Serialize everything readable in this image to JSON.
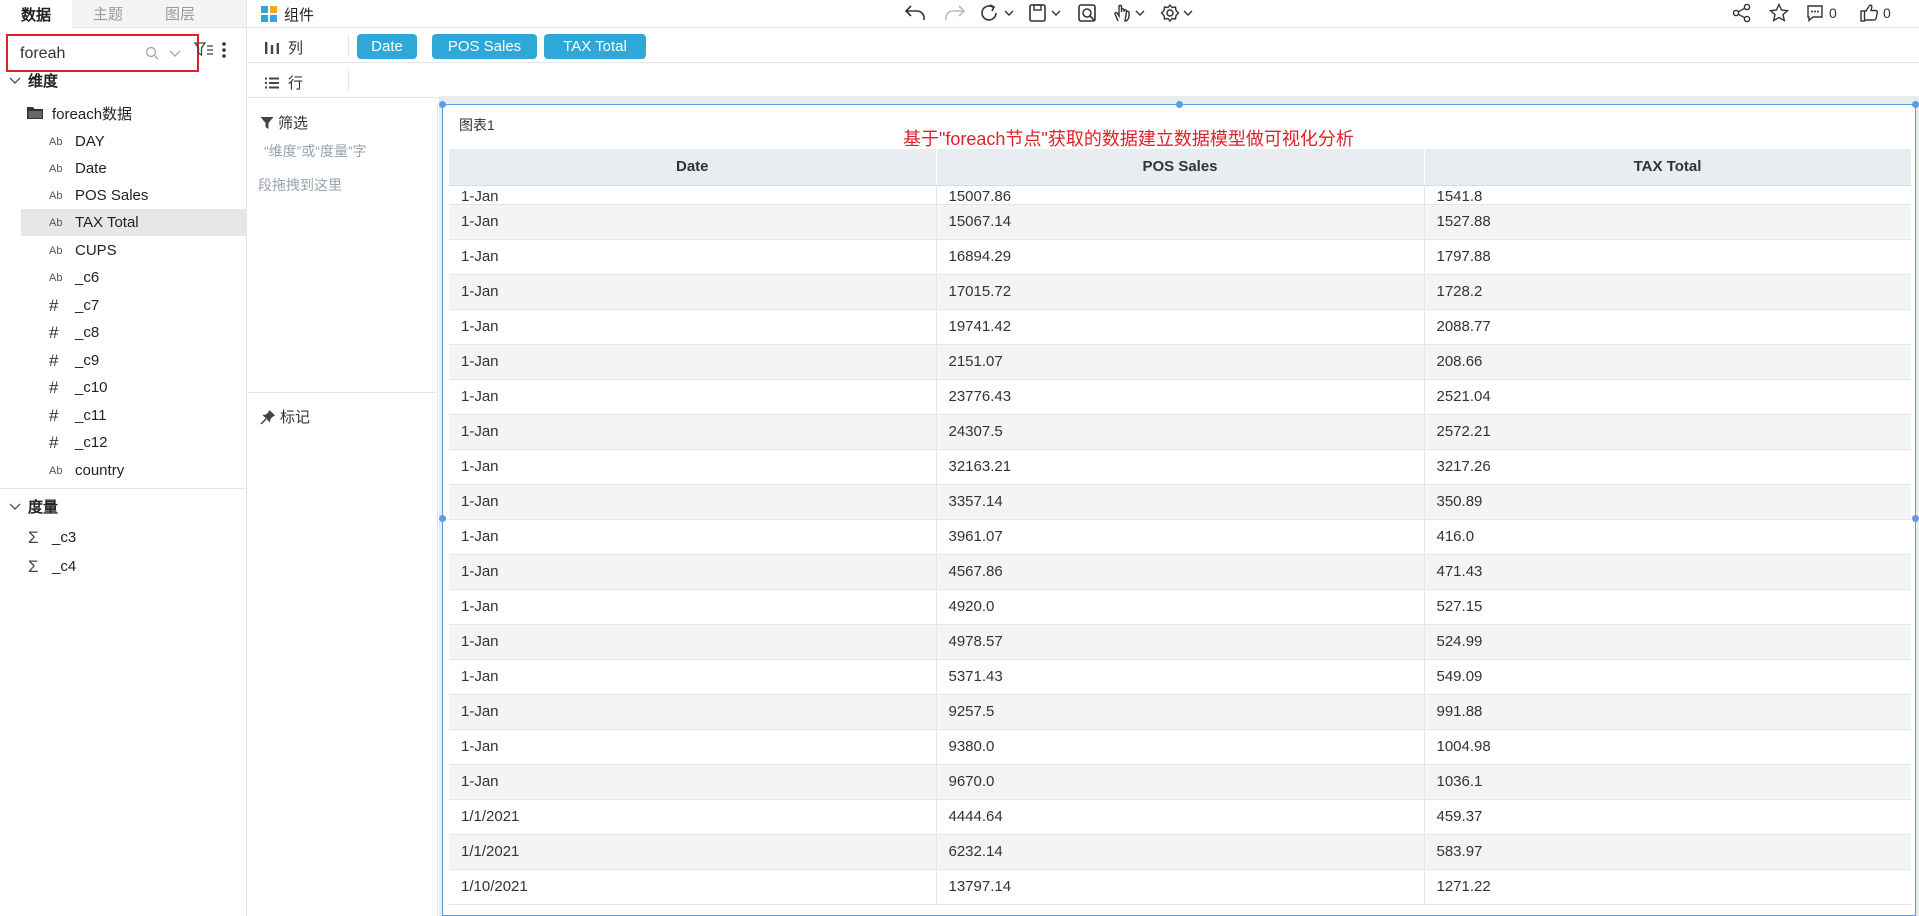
{
  "left_panel": {
    "tabs": [
      "数据",
      "主题",
      "图层"
    ],
    "search": {
      "value": "foreah"
    },
    "dimensions_header": "维度",
    "folder": "foreach数据",
    "fields": [
      {
        "type": "Ab",
        "name": "DAY"
      },
      {
        "type": "Ab",
        "name": "Date"
      },
      {
        "type": "Ab",
        "name": "POS Sales"
      },
      {
        "type": "Ab",
        "name": "TAX Total"
      },
      {
        "type": "Ab",
        "name": "CUPS"
      },
      {
        "type": "Ab",
        "name": "_c6"
      },
      {
        "type": "#",
        "name": "_c7"
      },
      {
        "type": "#",
        "name": "_c8"
      },
      {
        "type": "#",
        "name": "_c9"
      },
      {
        "type": "#",
        "name": "_c10"
      },
      {
        "type": "#",
        "name": "_c11"
      },
      {
        "type": "#",
        "name": "_c12"
      },
      {
        "type": "Ab",
        "name": "country"
      }
    ],
    "measures_header": "度量",
    "measures": [
      "_c3",
      "_c4"
    ],
    "measure_symbol": "Σ"
  },
  "toolbar": {
    "component_label": "组件",
    "comment_count": "0",
    "like_count": "0"
  },
  "shelves": {
    "columns_label": "列",
    "rows_label": "行",
    "column_pills": [
      "Date",
      "POS Sales",
      "TAX Total"
    ]
  },
  "filter_panel": {
    "filter_title": "筛选",
    "hint_line1": "“维度”或“度量”字",
    "hint_line2": "段拖拽到这里",
    "mark_title": "标记"
  },
  "chart": {
    "title": "图表1",
    "caption": "基于\"foreach节点\"获取的数据建立数据模型做可视化分析",
    "columns": [
      "Date",
      "POS Sales",
      "TAX Total"
    ],
    "rows": [
      [
        "1-Jan",
        "15007.86",
        "1541.8"
      ],
      [
        "1-Jan",
        "15067.14",
        "1527.88"
      ],
      [
        "1-Jan",
        "16894.29",
        "1797.88"
      ],
      [
        "1-Jan",
        "17015.72",
        "1728.2"
      ],
      [
        "1-Jan",
        "19741.42",
        "2088.77"
      ],
      [
        "1-Jan",
        "2151.07",
        "208.66"
      ],
      [
        "1-Jan",
        "23776.43",
        "2521.04"
      ],
      [
        "1-Jan",
        "24307.5",
        "2572.21"
      ],
      [
        "1-Jan",
        "32163.21",
        "3217.26"
      ],
      [
        "1-Jan",
        "3357.14",
        "350.89"
      ],
      [
        "1-Jan",
        "3961.07",
        "416.0"
      ],
      [
        "1-Jan",
        "4567.86",
        "471.43"
      ],
      [
        "1-Jan",
        "4920.0",
        "527.15"
      ],
      [
        "1-Jan",
        "4978.57",
        "524.99"
      ],
      [
        "1-Jan",
        "5371.43",
        "549.09"
      ],
      [
        "1-Jan",
        "9257.5",
        "991.88"
      ],
      [
        "1-Jan",
        "9380.0",
        "1004.98"
      ],
      [
        "1-Jan",
        "9670.0",
        "1036.1"
      ],
      [
        "1/1/2021",
        "4444.64",
        "459.37"
      ],
      [
        "1/1/2021",
        "6232.14",
        "583.97"
      ],
      [
        "1/10/2021",
        "13797.14",
        "1271.22"
      ]
    ]
  },
  "colors": {
    "accent": "#2fa8d8",
    "selection_border": "#5a9de8",
    "highlight_red": "#e0212b"
  }
}
